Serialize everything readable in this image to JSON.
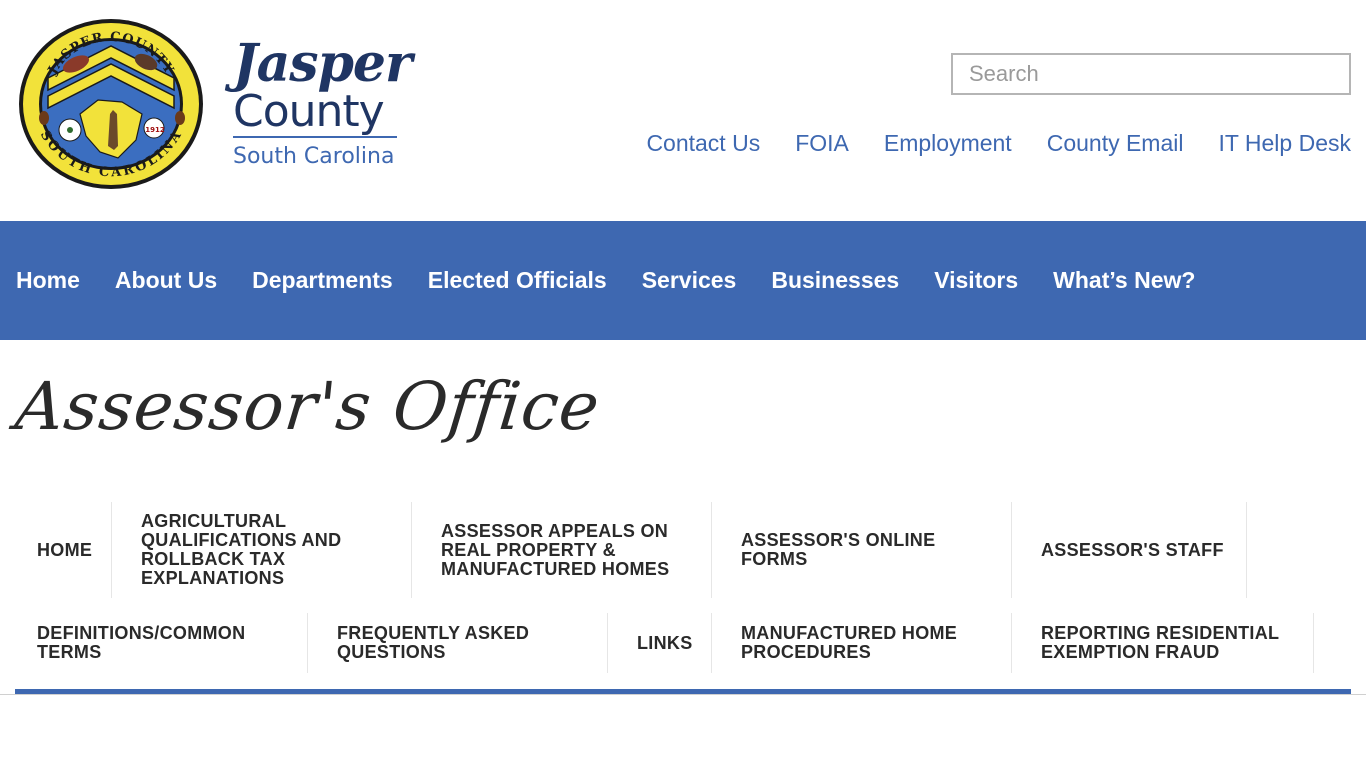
{
  "header": {
    "seal_text_top": "JASPER COUNTY",
    "seal_text_bottom": "SOUTH CAROLINA",
    "seal_year": "1912",
    "logo_line1": "Jasper",
    "logo_line2": "County",
    "logo_line3": "South Carolina",
    "search_placeholder": "Search"
  },
  "utility_nav": [
    "Contact Us",
    "FOIA",
    "Employment",
    "County Email",
    "IT Help Desk"
  ],
  "main_nav": [
    "Home",
    "About Us",
    "Departments",
    "Elected Officials",
    "Services",
    "Businesses",
    "Visitors",
    "What’s New?"
  ],
  "page": {
    "title": "Assessor's Office"
  },
  "sub_nav": {
    "row1": [
      "HOME",
      "AGRICULTURAL QUALIFICATIONS AND ROLLBACK TAX EXPLANATIONS",
      "ASSESSOR APPEALS ON REAL PROPERTY & MANUFACTURED HOMES",
      "ASSESSOR'S ONLINE FORMS",
      "ASSESSOR'S STAFF"
    ],
    "row2": [
      "DEFINITIONS/COMMON TERMS",
      "FREQUENTLY ASKED QUESTIONS",
      "LINKS",
      "MANUFACTURED HOME PROCEDURES",
      "REPORTING RESIDENTIAL EXEMPTION FRAUD"
    ]
  },
  "colors": {
    "brand_blue": "#3e68b1",
    "logo_navy": "#1f3563",
    "seal_yellow": "#f2e23a",
    "seal_blue": "#3b6ec0"
  }
}
